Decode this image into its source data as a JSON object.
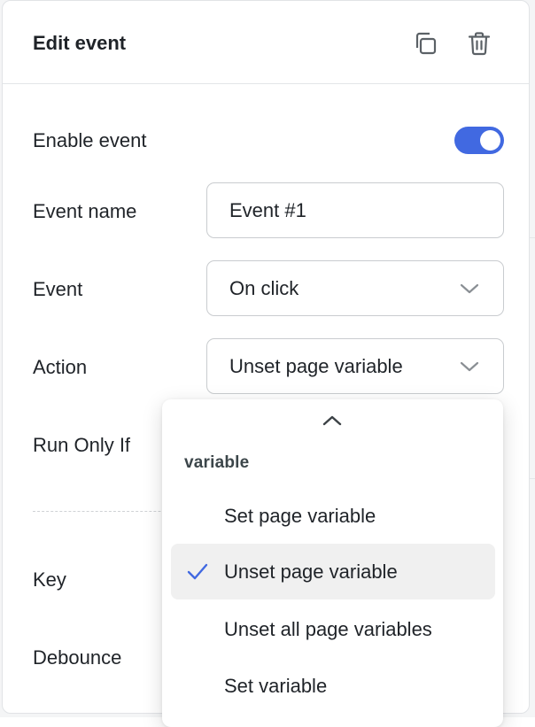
{
  "header": {
    "title": "Edit event",
    "duplicate_icon": "copy-icon",
    "delete_icon": "trash-icon"
  },
  "form": {
    "enable_event": {
      "label": "Enable event",
      "enabled": true
    },
    "event_name": {
      "label": "Event name",
      "value": "Event #1"
    },
    "event": {
      "label": "Event",
      "value": "On click"
    },
    "action": {
      "label": "Action",
      "value": "Unset page variable"
    },
    "run_only_if": {
      "label": "Run Only If"
    },
    "key": {
      "label": "Key"
    },
    "debounce": {
      "label": "Debounce"
    }
  },
  "dropdown": {
    "group_label": "variable",
    "options": [
      {
        "label": "Set page variable",
        "selected": false
      },
      {
        "label": "Unset page variable",
        "selected": true
      },
      {
        "label": "Unset all page variables",
        "selected": false
      },
      {
        "label": "Set variable",
        "selected": false
      }
    ]
  },
  "colors": {
    "accent": "#4169e1",
    "text": "#1f2328",
    "selected_bg": "#f0f0f0"
  }
}
